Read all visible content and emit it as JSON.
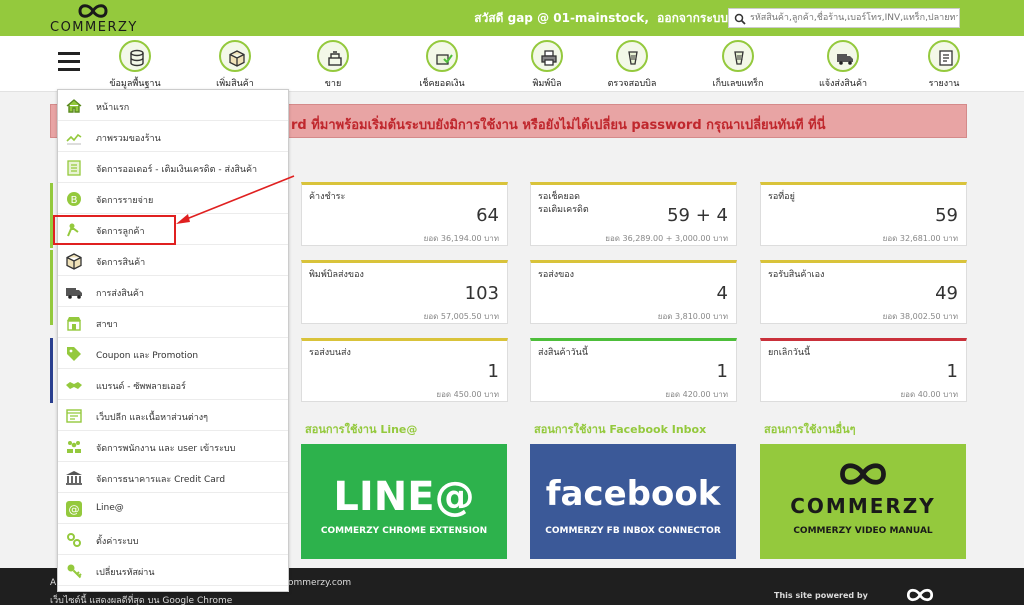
{
  "header": {
    "logo_text": "COMMERZY",
    "greeting": "สวัสดี gap @ 01-mainstock,",
    "logout": "ออกจากระบบ",
    "search_placeholder": "รหัสสินค้า,ลูกค้า,ชื่อร้าน,เบอร์โทร,INV,แทร็ก,ปลายทาง"
  },
  "nav": {
    "items": [
      {
        "label": "ข้อมูลพื้นฐาน",
        "icon": "database-icon"
      },
      {
        "label": "เพิ่มสินค้า",
        "icon": "box-icon"
      },
      {
        "label": "ขาย",
        "icon": "scale-icon"
      },
      {
        "label": "เช็คยอดเงิน",
        "icon": "money-check-icon"
      },
      {
        "label": "พิมพ์บิล",
        "icon": "printer-icon"
      },
      {
        "label": "ตรวจสอบบิล",
        "icon": "barcode-scan-icon"
      },
      {
        "label": "เก็บเลขแทร็ก",
        "icon": "barcode-scan-icon"
      },
      {
        "label": "แจ้งส่งสินค้า",
        "icon": "truck-icon"
      },
      {
        "label": "รายงาน",
        "icon": "report-icon"
      }
    ]
  },
  "alert": {
    "text": "rd ที่มาพร้อมเริ่มต้นระบบยังมิการใช้งาน หรือยังไม่ได้เปลี่ยน password กรุณาเปลี่ยนทันที ที่นี่"
  },
  "dropdown": {
    "items": [
      {
        "label": "หน้าแรก",
        "icon": "home-icon"
      },
      {
        "label": "ภาพรวมของร้าน",
        "icon": "chart-line-icon"
      },
      {
        "label": "จัดการออเดอร์ - เติมเงินเครดิต - ส่งสินค้า",
        "icon": "order-icon"
      },
      {
        "label": "จัดการรายจ่าย",
        "icon": "coin-icon"
      },
      {
        "label": "จัดการลูกค้า",
        "icon": "customer-icon"
      },
      {
        "label": "จัดการสินค้า",
        "icon": "box-icon"
      },
      {
        "label": "การส่งสินค้า",
        "icon": "truck-icon"
      },
      {
        "label": "สาขา",
        "icon": "store-icon"
      },
      {
        "label": "Coupon และ Promotion",
        "icon": "tag-icon"
      },
      {
        "label": "แบรนด์ - ซัพพลายเออร์",
        "icon": "handshake-icon"
      },
      {
        "label": "เว็บปลีก และเนื้อหาส่วนต่างๆ",
        "icon": "web-icon"
      },
      {
        "label": "จัดการพนักงาน และ user เข้าระบบ",
        "icon": "staff-icon"
      },
      {
        "label": "จัดการธนาคารและ Credit Card",
        "icon": "bank-icon"
      },
      {
        "label": "Line@",
        "icon": "at-icon"
      },
      {
        "label": "ตั้งค่าระบบ",
        "icon": "settings-icon"
      },
      {
        "label": "เปลี่ยนรหัสผ่าน",
        "icon": "key-icon"
      }
    ]
  },
  "cards": [
    {
      "title": "ค้างชำระ",
      "value": "64",
      "sub": "ยอด 36,194.00 บาท",
      "color": "yellow"
    },
    {
      "title": "รอเช็คยอด\nรอเติมเครดิต",
      "value": "59 + 4",
      "sub": "ยอด 36,289.00 + 3,000.00 บาท",
      "color": "yellow"
    },
    {
      "title": "รอที่อยู่",
      "value": "59",
      "sub": "ยอด 32,681.00 บาท",
      "color": "yellow"
    },
    {
      "title": "พิมพ์บิลส่งของ",
      "value": "103",
      "sub": "ยอด 57,005.50 บาท",
      "color": "yellow"
    },
    {
      "title": "รอส่งของ",
      "value": "4",
      "sub": "ยอด 3,810.00 บาท",
      "color": "yellow"
    },
    {
      "title": "รอรับสินค้าเอง",
      "value": "49",
      "sub": "ยอด 38,002.50 บาท",
      "color": "yellow"
    },
    {
      "title": "รอส่งบนส่ง",
      "value": "1",
      "sub": "ยอด 450.00 บาท",
      "color": "yellow"
    },
    {
      "title": "ส่งสินค้าวันนี้",
      "value": "1",
      "sub": "ยอด 420.00 บาท",
      "color": "green"
    },
    {
      "title": "ยกเลิกวันนี้",
      "value": "1",
      "sub": "ยอด 40.00 บาท",
      "color": "red"
    }
  ],
  "tutorials": [
    {
      "heading": "สอนการใช้งาน Line@",
      "big": "LINE@",
      "sub": "COMMERZY CHROME EXTENSION"
    },
    {
      "heading": "สอนการใช้งาน Facebook Inbox",
      "big": "facebook",
      "sub": "COMMERZY FB INBOX CONNECTOR"
    },
    {
      "heading": "สอนการใช้งานอื่นๆ",
      "big": "COMMERZY",
      "sub": "COMMERZY VIDEO MANUAL"
    }
  ],
  "footer": {
    "prefix": "A",
    "email": "ommerzy.com",
    "browser_note": "เว็บไซต์นี้ แสดงผลดีที่สุด บน Google Chrome",
    "powered": "This site powered by"
  },
  "colors": {
    "brand_green": "#94c93d",
    "alert_bg": "#e8a4a4",
    "alert_text": "#c0272d",
    "card_yellow": "#d9c33a",
    "card_green": "#4dbe3a",
    "card_red": "#c9303a",
    "line_green": "#2db24c",
    "facebook_blue": "#3b5998",
    "highlight_red": "#e02020"
  }
}
